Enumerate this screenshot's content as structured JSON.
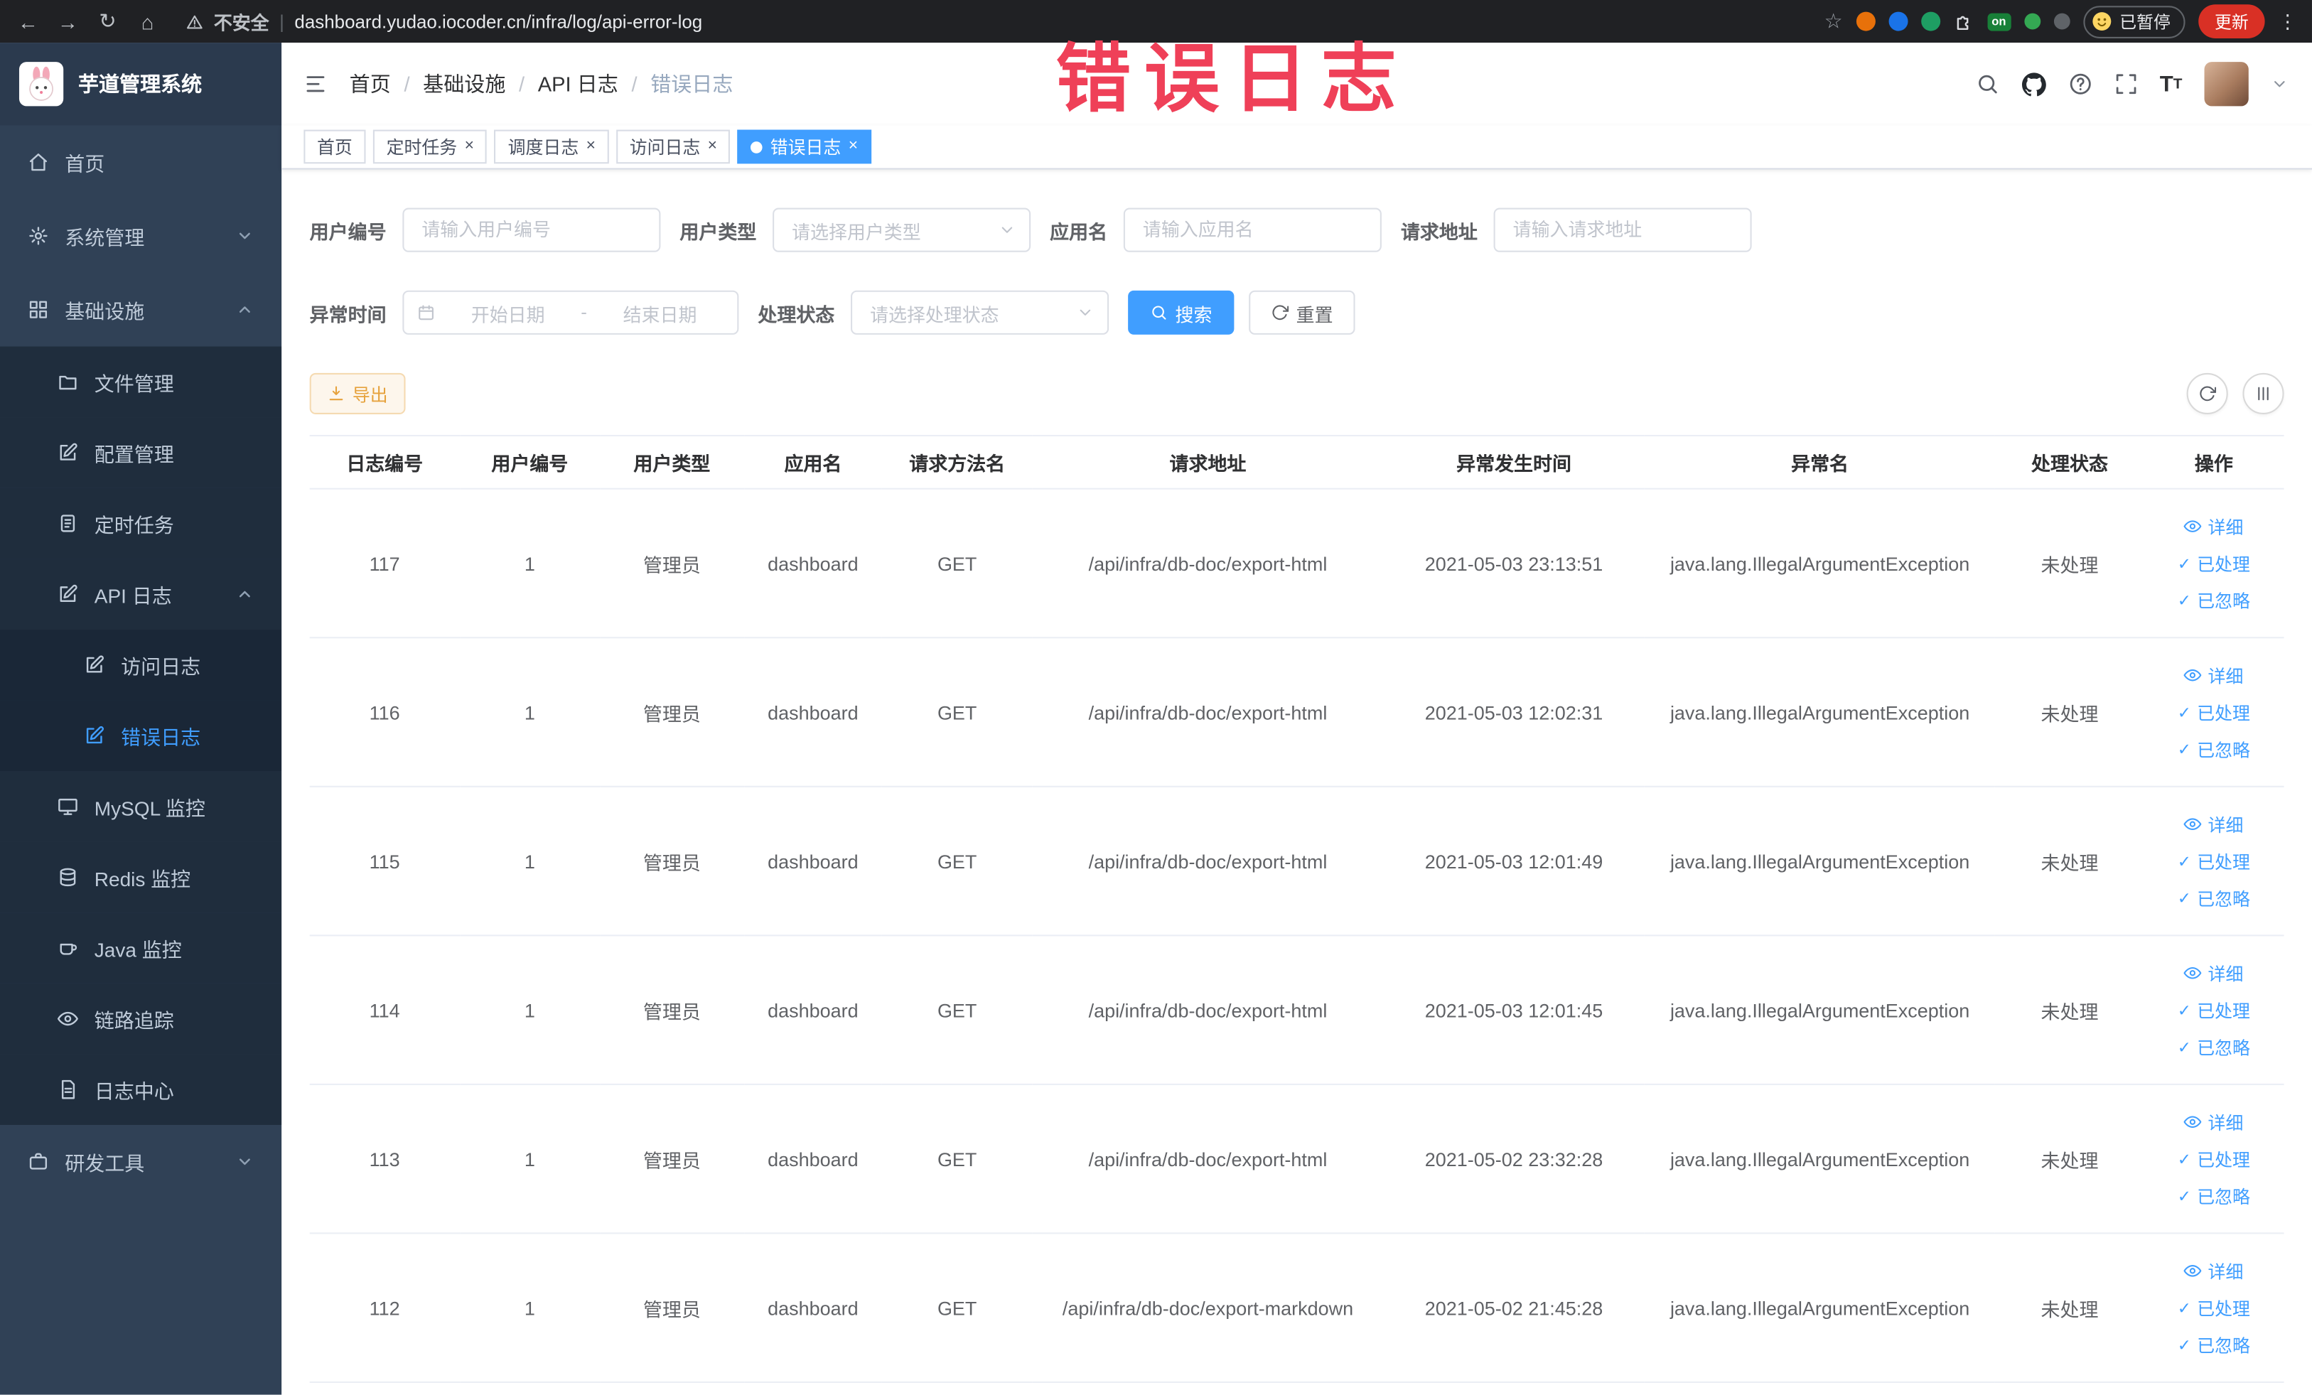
{
  "browser": {
    "security_label": "不安全",
    "url": "dashboard.yudao.iocoder.cn/infra/log/api-error-log",
    "extension_badge": "on",
    "paused_label": "已暂停",
    "update_label": "更新"
  },
  "annotation": {
    "text": "错误日志"
  },
  "sidebar": {
    "logo_title": "芋道管理系统",
    "items": [
      {
        "label": "首页"
      },
      {
        "label": "系统管理"
      },
      {
        "label": "基础设施",
        "children": [
          {
            "label": "文件管理"
          },
          {
            "label": "配置管理"
          },
          {
            "label": "定时任务"
          },
          {
            "label": "API 日志",
            "children": [
              {
                "label": "访问日志"
              },
              {
                "label": "错误日志"
              }
            ]
          },
          {
            "label": "MySQL 监控"
          },
          {
            "label": "Redis 监控"
          },
          {
            "label": "Java 监控"
          },
          {
            "label": "链路追踪"
          },
          {
            "label": "日志中心"
          }
        ]
      },
      {
        "label": "研发工具"
      }
    ]
  },
  "header": {
    "breadcrumb": [
      "首页",
      "基础设施",
      "API 日志",
      "错误日志"
    ],
    "breadcrumb_separator": "/"
  },
  "tabs": [
    {
      "label": "首页",
      "closable": false,
      "active": false
    },
    {
      "label": "定时任务",
      "closable": true,
      "active": false
    },
    {
      "label": "调度日志",
      "closable": true,
      "active": false
    },
    {
      "label": "访问日志",
      "closable": true,
      "active": false
    },
    {
      "label": "错误日志",
      "closable": true,
      "active": true
    }
  ],
  "filters": {
    "user_id": {
      "label": "用户编号",
      "placeholder": "请输入用户编号"
    },
    "user_type": {
      "label": "用户类型",
      "placeholder": "请选择用户类型"
    },
    "app_name": {
      "label": "应用名",
      "placeholder": "请输入应用名"
    },
    "request_url": {
      "label": "请求地址",
      "placeholder": "请输入请求地址"
    },
    "exception_time": {
      "label": "异常时间",
      "start_placeholder": "开始日期",
      "separator": "-",
      "end_placeholder": "结束日期"
    },
    "process_status": {
      "label": "处理状态",
      "placeholder": "请选择处理状态"
    },
    "search_label": "搜索",
    "reset_label": "重置"
  },
  "toolbar": {
    "export_label": "导出"
  },
  "table": {
    "columns": [
      "日志编号",
      "用户编号",
      "用户类型",
      "应用名",
      "请求方法名",
      "请求地址",
      "异常发生时间",
      "异常名",
      "处理状态",
      "操作"
    ],
    "actions": {
      "detail": "详细",
      "processed": "已处理",
      "ignored": "已忽略"
    },
    "rows": [
      {
        "id": "117",
        "user_id": "1",
        "user_type": "管理员",
        "app": "dashboard",
        "method": "GET",
        "url": "/api/infra/db-doc/export-html",
        "time": "2021-05-03 23:13:51",
        "exception": "java.lang.IllegalArgumentException",
        "status": "未处理"
      },
      {
        "id": "116",
        "user_id": "1",
        "user_type": "管理员",
        "app": "dashboard",
        "method": "GET",
        "url": "/api/infra/db-doc/export-html",
        "time": "2021-05-03 12:02:31",
        "exception": "java.lang.IllegalArgumentException",
        "status": "未处理"
      },
      {
        "id": "115",
        "user_id": "1",
        "user_type": "管理员",
        "app": "dashboard",
        "method": "GET",
        "url": "/api/infra/db-doc/export-html",
        "time": "2021-05-03 12:01:49",
        "exception": "java.lang.IllegalArgumentException",
        "status": "未处理"
      },
      {
        "id": "114",
        "user_id": "1",
        "user_type": "管理员",
        "app": "dashboard",
        "method": "GET",
        "url": "/api/infra/db-doc/export-html",
        "time": "2021-05-03 12:01:45",
        "exception": "java.lang.IllegalArgumentException",
        "status": "未处理"
      },
      {
        "id": "113",
        "user_id": "1",
        "user_type": "管理员",
        "app": "dashboard",
        "method": "GET",
        "url": "/api/infra/db-doc/export-html",
        "time": "2021-05-02 23:32:28",
        "exception": "java.lang.IllegalArgumentException",
        "status": "未处理"
      },
      {
        "id": "112",
        "user_id": "1",
        "user_type": "管理员",
        "app": "dashboard",
        "method": "GET",
        "url": "/api/infra/db-doc/export-markdown",
        "time": "2021-05-02 21:45:28",
        "exception": "java.lang.IllegalArgumentException",
        "status": "未处理"
      }
    ]
  },
  "colors": {
    "primary": "#409eff",
    "warning": "#e6a23c",
    "annotation_red": "#ef4058",
    "sidebar_bg": "#304156",
    "submenu_bg": "#1f2d3d"
  }
}
